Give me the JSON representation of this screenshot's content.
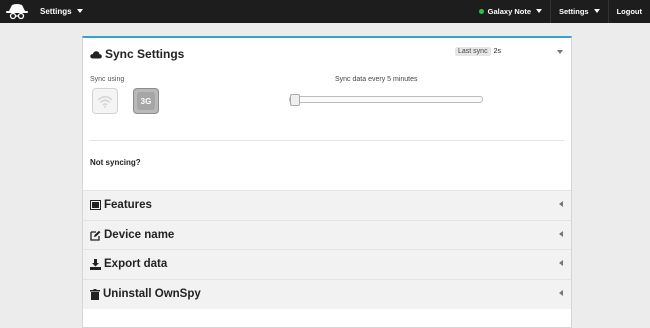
{
  "topbar": {
    "app_menu_label": "Settings",
    "device_label": "Galaxy Note",
    "device_status_color": "#2fbf4a",
    "settings_label": "Settings",
    "logout_label": "Logout"
  },
  "sync_settings": {
    "title": "Sync Settings",
    "icon": "cloud-icon",
    "last_sync_label": "Last sync",
    "last_sync_value": "2s",
    "sync_using_label": "Sync using",
    "options": [
      {
        "name": "wifi",
        "icon": "wifi-icon",
        "selected": false
      },
      {
        "name": "3g",
        "label": "3G",
        "selected": true
      }
    ],
    "interval_label": "Sync data every 5 minutes",
    "interval_slider_fraction": 0,
    "not_syncing_label": "Not syncing?"
  },
  "sections": [
    {
      "title": "Features",
      "icon": "features-icon"
    },
    {
      "title": "Device name",
      "icon": "edit-icon"
    },
    {
      "title": "Export data",
      "icon": "download-icon"
    },
    {
      "title": "Uninstall OwnSpy",
      "icon": "trash-icon"
    }
  ]
}
